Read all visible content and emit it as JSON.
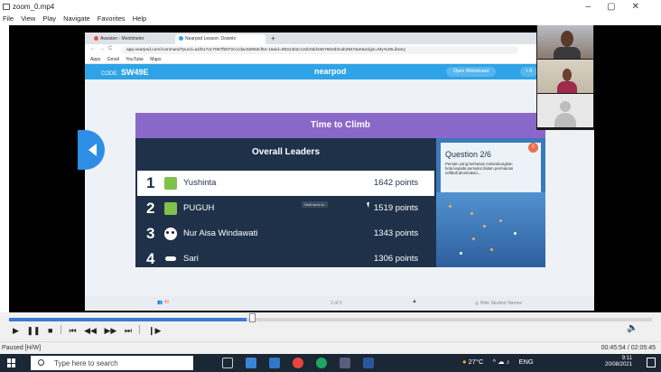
{
  "window": {
    "title": "zoom_0.mp4",
    "menu": [
      "File",
      "View",
      "Play",
      "Navigate",
      "Favorites",
      "Help"
    ]
  },
  "browser": {
    "tabs": [
      {
        "label": "Awesten - Mentimeter",
        "color": "#e6523d"
      },
      {
        "label": "Nearpod Lesson: Downlo",
        "color": "#2ea3e7"
      }
    ],
    "url": "app.nearpod.com/command?pucd=a1f6174c7067f5072cccdac52853cf64-1&sid=08314b2cc2dc0dd3467660d3cab2947&et&origin=My%20Library",
    "bookmarks": [
      "Apps",
      "Gmail",
      "YouTube",
      "Maps"
    ]
  },
  "nearpod": {
    "code_label": "CODE:",
    "code": "SW49E",
    "logo": "nearpod",
    "whiteboard": "Open Whiteboard",
    "more": "+ A",
    "banner": "Time to Climb",
    "board_title": "Overall Leaders",
    "leaders": [
      {
        "rank": "1",
        "name": "Yushinta",
        "points": "1642 points",
        "avatar": "green"
      },
      {
        "rank": "2",
        "name": "PUGUH",
        "points": "1519 points",
        "avatar": "green"
      },
      {
        "rank": "3",
        "name": "Nur Aisa Windawati",
        "points": "1343 points",
        "avatar": "panda"
      },
      {
        "rank": "4",
        "name": "Sari",
        "points": "1306 points",
        "avatar": "mask"
      }
    ],
    "tooltip": "Sedi sedu d..",
    "question": {
      "title": "Question 2/6",
      "text": "Pemain yang berhasas melambungkan bola kepada pemukul dalam permainan softball dinamakan...",
      "badge": "0"
    },
    "footer": {
      "students": "40",
      "page": "2 of 2",
      "hide": "Hide Student Names"
    }
  },
  "player": {
    "status": "Paused [H/W]",
    "time": "00:45:54 / 02:05:45",
    "progress": 0.37
  },
  "taskbar": {
    "search_placeholder": "Type here to search",
    "weather": "27°C",
    "lang": "ENG",
    "time": "9:11",
    "date": "20/08/2021"
  }
}
